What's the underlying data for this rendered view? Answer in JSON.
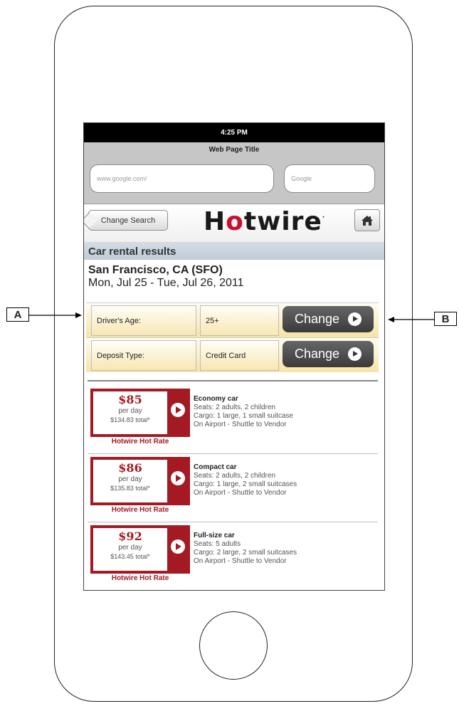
{
  "status_bar": {
    "time": "4:25 PM"
  },
  "browser": {
    "page_title": "Web Page Title",
    "url_value": "www.google.com/",
    "search_value": "Google"
  },
  "header": {
    "change_search_label": "Change Search",
    "logo_text_before": "H",
    "logo_o": "o",
    "logo_text_after": "twire",
    "logo_mark": "·",
    "home_icon": "home-icon"
  },
  "results": {
    "title": "Car rental results",
    "location": "San Francisco, CA (SFO)",
    "dates": "Mon, Jul 25 - Tue, Jul 26, 2011"
  },
  "filters": [
    {
      "label": "Driver's Age:",
      "value": "25+",
      "button": "Change"
    },
    {
      "label": "Deposit Type:",
      "value": "Credit Card",
      "button": "Change"
    }
  ],
  "cars": [
    {
      "price": "$85",
      "per_day": "per day",
      "total": "$134.83 total*",
      "hot_rate": "Hotwire Hot Rate",
      "name": "Economy car",
      "seats": "Seats: 2 adults, 2 children",
      "cargo": "Cargo: 1 large, 1 small suitcase",
      "location": "On Airport - Shuttle to Vendor"
    },
    {
      "price": "$86",
      "per_day": "per day",
      "total": "$135.83 total*",
      "hot_rate": "Hotwire Hot Rate",
      "name": "Compact car",
      "seats": "Seats: 2 adults, 2 children",
      "cargo": "Cargo: 1 large, 2 small suitcases",
      "location": "On Airport - Shuttle to Vendor"
    },
    {
      "price": "$92",
      "per_day": "per day",
      "total": "$143.45 total*",
      "hot_rate": "Hotwire Hot Rate",
      "name": "Full-size car",
      "seats": "Seats: 5 adults",
      "cargo": "Cargo: 2 large, 2 small suitcases",
      "location": "On Airport - Shuttle to Vendor"
    }
  ],
  "annotations": {
    "left": "A",
    "right": "B"
  }
}
